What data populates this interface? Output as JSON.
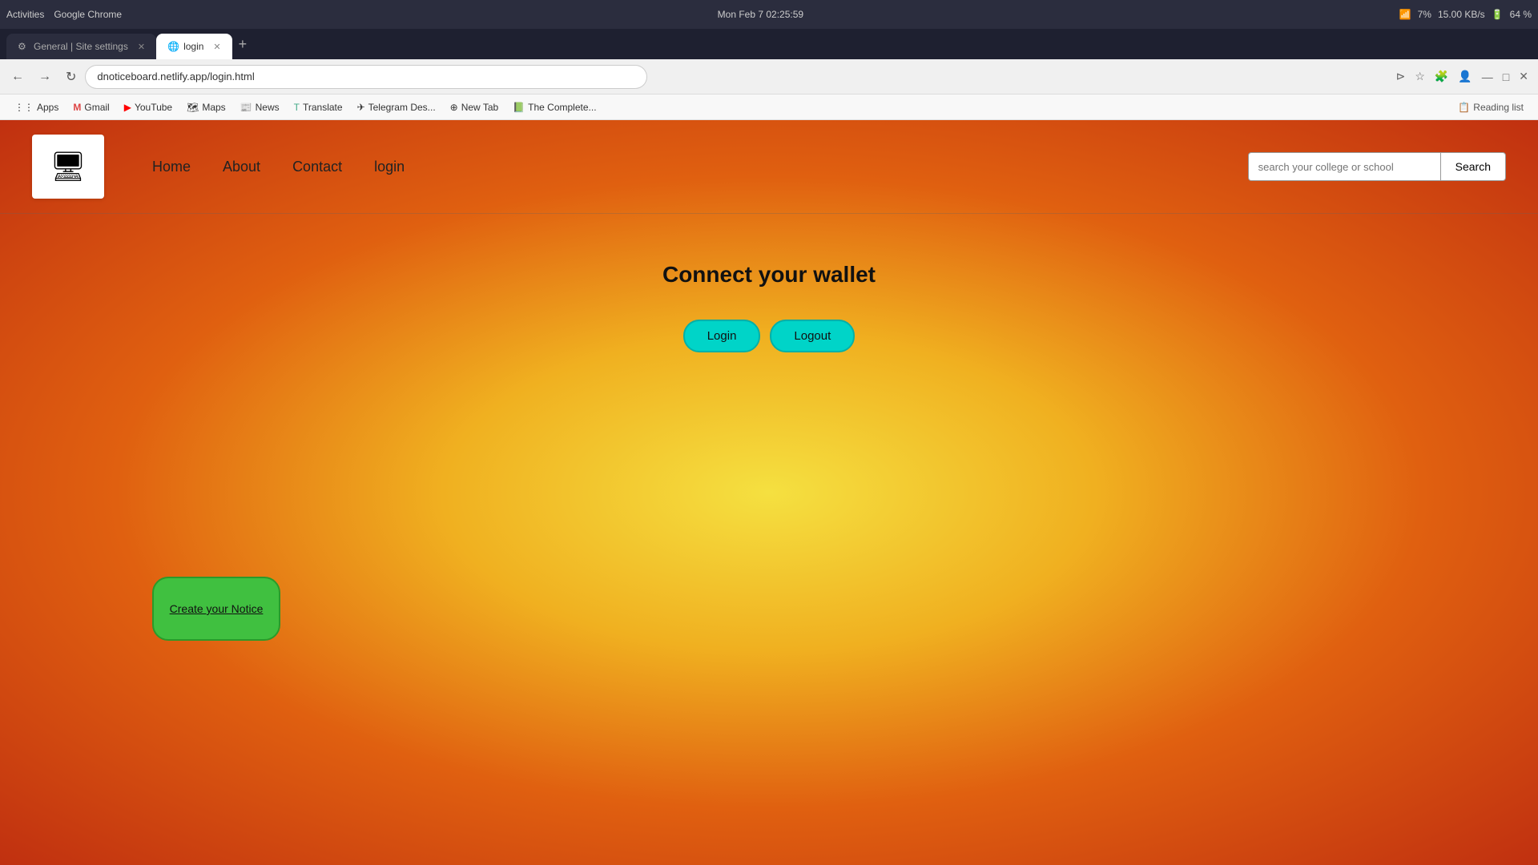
{
  "browser": {
    "topbar": {
      "left_label": "Activities",
      "browser_label": "Google Chrome",
      "datetime": "Mon Feb 7  02:25:59",
      "battery": "64 %",
      "network": "15.00 KB/s",
      "wifi_strength": "7%"
    },
    "tabs": [
      {
        "id": "tab1",
        "favicon": "⚙",
        "label": "General | Site settings",
        "active": false
      },
      {
        "id": "tab2",
        "favicon": "🌐",
        "label": "login",
        "active": true
      }
    ],
    "address": "dnoticeboard.netlify.app/login.html",
    "bookmarks": [
      {
        "id": "apps",
        "icon": "⋮⋮",
        "label": "Apps"
      },
      {
        "id": "gmail",
        "icon": "M",
        "label": "Gmail"
      },
      {
        "id": "youtube",
        "icon": "▶",
        "label": "YouTube"
      },
      {
        "id": "maps",
        "icon": "🗺",
        "label": "Maps"
      },
      {
        "id": "news",
        "icon": "📰",
        "label": "News"
      },
      {
        "id": "translate",
        "icon": "T",
        "label": "Translate"
      },
      {
        "id": "telegram",
        "icon": "✈",
        "label": "Telegram Des..."
      },
      {
        "id": "newtab",
        "icon": "⊕",
        "label": "New Tab"
      },
      {
        "id": "thecomplete",
        "icon": "📗",
        "label": "The Complete..."
      }
    ],
    "reading_list": "Reading list"
  },
  "page": {
    "nav": {
      "links": [
        {
          "id": "home",
          "label": "Home"
        },
        {
          "id": "about",
          "label": "About"
        },
        {
          "id": "contact",
          "label": "Contact"
        },
        {
          "id": "login",
          "label": "login"
        }
      ],
      "search_placeholder": "search your college or school",
      "search_button": "Search"
    },
    "main": {
      "title": "Connect your wallet",
      "login_btn": "Login",
      "logout_btn": "Logout",
      "create_notice_btn": "Create your Notice"
    }
  }
}
